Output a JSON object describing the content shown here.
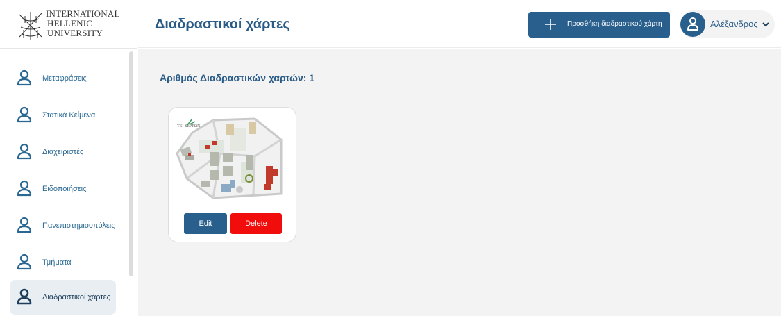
{
  "logo": {
    "lines": [
      "INTERNATIONAL",
      "HELLENIC",
      "UNIVERSITY"
    ]
  },
  "sidebar": {
    "items": [
      {
        "label": "Μεταφράσεις",
        "icon": "user-icon",
        "active": false
      },
      {
        "label": "Στατικά Κείμενα",
        "icon": "user-icon",
        "active": false
      },
      {
        "label": "Διαχειριστές",
        "icon": "user-icon",
        "active": false
      },
      {
        "label": "Ειδοποιήσεις",
        "icon": "user-icon",
        "active": false
      },
      {
        "label": "Πανεπιστημιουπόλεις",
        "icon": "user-icon",
        "active": false
      },
      {
        "label": "Τμήματα",
        "icon": "user-icon",
        "active": false
      },
      {
        "label": "Διαδραστικοί χάρτες",
        "icon": "user-icon",
        "active": true
      }
    ]
  },
  "header": {
    "title": "Διαδραστικοί χάρτες",
    "add_button_label": "Προσθήκη διαδραστικού χάρτη",
    "add_button_icon": "plus-icon",
    "user_name": "Αλέξανδρος",
    "user_icon": "user-icon",
    "user_menu_icon": "chevron-down-icon"
  },
  "main": {
    "count_label": "Αριθμός Διαδραστικών χαρτών: 1",
    "maps": [
      {
        "thumbnail_logo_text": "ΤΕΙ ΣΕΡΡΩΝ",
        "edit_label": "Edit",
        "delete_label": "Delete"
      }
    ]
  },
  "colors": {
    "primary": "#285f8c",
    "title": "#2a5b86",
    "danger": "#f20d0d",
    "background": "#f3f3f3",
    "active_item": "#e9eef3"
  }
}
